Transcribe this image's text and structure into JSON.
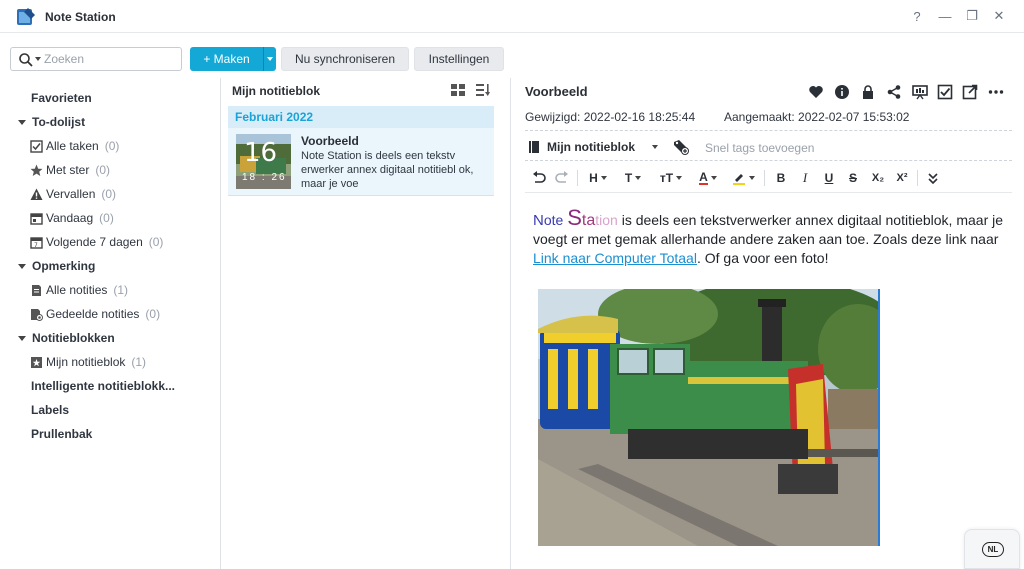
{
  "window": {
    "title": "Note Station",
    "help": "?",
    "minimize": "—",
    "restore": "❐",
    "close": "✕"
  },
  "toolbar": {
    "search_placeholder": "Zoeken",
    "create_label": "+ Maken",
    "sync_label": "Nu synchroniseren",
    "settings_label": "Instellingen"
  },
  "sidebar": {
    "favorites": "Favorieten",
    "todo": {
      "label": "To-dolijst",
      "items": [
        {
          "label": "Alle taken",
          "count": "(0)",
          "icon": "checkbox-icon"
        },
        {
          "label": "Met ster",
          "count": "(0)",
          "icon": "star-icon"
        },
        {
          "label": "Vervallen",
          "count": "(0)",
          "icon": "warning-icon"
        },
        {
          "label": "Vandaag",
          "count": "(0)",
          "icon": "calendar-icon"
        },
        {
          "label": "Volgende 7 dagen",
          "count": "(0)",
          "icon": "calendar-week-icon"
        }
      ]
    },
    "notes": {
      "label": "Opmerking",
      "items": [
        {
          "label": "Alle notities",
          "count": "(1)",
          "icon": "notes-icon"
        },
        {
          "label": "Gedeelde notities",
          "count": "(0)",
          "icon": "shared-notes-icon"
        }
      ]
    },
    "notebooks": {
      "label": "Notitieblokken",
      "items": [
        {
          "label": "Mijn notitieblok",
          "count": "(1)",
          "icon": "notebook-icon"
        }
      ]
    },
    "smart_notebooks": "Intelligente notitieblokk...",
    "labels": "Labels",
    "trash": "Prullenbak"
  },
  "note_list": {
    "title": "Mijn notitieblok",
    "month": "Februari 2022",
    "notes": [
      {
        "title": "Voorbeeld",
        "snippet": "Note Station is deels een tekstv erwerker annex digitaal notitiebl ok, maar je voe",
        "thumb_day": "16",
        "thumb_time": "18 : 26"
      }
    ]
  },
  "editor": {
    "title": "Voorbeeld",
    "modified": "Gewijzigd: 2022-02-16 18:25:44",
    "created": "Aangemaakt: 2022-02-07 15:53:02",
    "notebook": "Mijn notitieblok",
    "tags_placeholder": "Snel tags toevoegen",
    "format": {
      "heading": "H",
      "font": "T",
      "size": "тT",
      "color": "A",
      "bold": "B",
      "italic": "I",
      "underline": "U",
      "strike": "S",
      "subscript": "X₂",
      "superscript": "X²"
    },
    "body": {
      "fancy_n": "N",
      "fancy_ote": "ote ",
      "fancy_s": "S",
      "fancy_ta": "ta",
      "fancy_tion": "tion",
      "text1": " is deels een tekstverwerker annex digitaal notitieblok, maar je voegt er met gemak allerhande andere zaken aan toe. Zoals deze link naar ",
      "link": "Link naar Computer Totaal",
      "text2": ". Of ga voor een foto!"
    }
  },
  "language": "NL",
  "colors": {
    "accent": "#14a8d6",
    "selected_row": "#eaf6fc",
    "month_header": "#d8edf8",
    "link": "#1a8fd1"
  }
}
